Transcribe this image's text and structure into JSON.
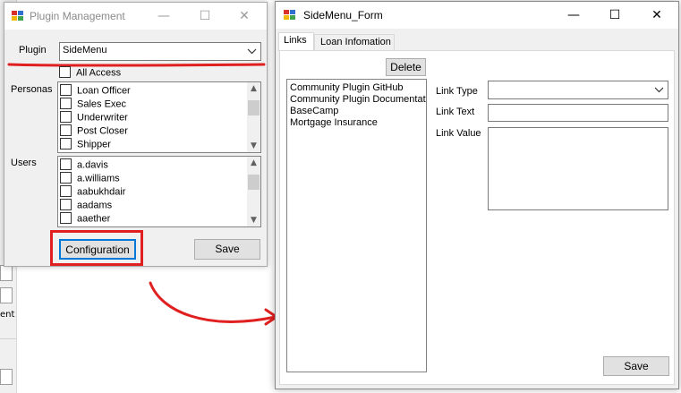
{
  "background_app": {
    "partial_text": "ent"
  },
  "plugin_window": {
    "title": "Plugin Management",
    "plugin_label": "Plugin",
    "plugin_value": "SideMenu",
    "all_access_label": "All Access",
    "personas_label": "Personas",
    "personas": [
      "Loan Officer",
      "Sales Exec",
      "Underwriter",
      "Post Closer",
      "Shipper"
    ],
    "users_label": "Users",
    "users": [
      "a.davis",
      "a.williams",
      "aabukhdair",
      "aadams",
      "aaether"
    ],
    "configuration_label": "Configuration",
    "save_label": "Save"
  },
  "sidemenu_window": {
    "title": "SideMenu_Form",
    "tabs": [
      {
        "label": "Links",
        "active": true
      },
      {
        "label": "Loan Infomation",
        "active": false
      }
    ],
    "delete_label": "Delete",
    "links": [
      "Community Plugin GitHub",
      "Community Plugin Documentatio",
      "BaseCamp",
      "Mortgage Insurance"
    ],
    "link_type_label": "Link Type",
    "link_type_value": "",
    "link_text_label": "Link Text",
    "link_text_value": "",
    "link_value_label": "Link Value",
    "link_value_value": "",
    "save_label": "Save"
  },
  "caption_glyphs": {
    "minimize": "—",
    "maximize": "☐",
    "close": "✕"
  },
  "colors": {
    "annotation_red": "#e02020",
    "focus_blue": "#0078d7",
    "icon_red": "#d9302c",
    "icon_blue": "#2f6fd0",
    "icon_yellow": "#f2b705"
  }
}
